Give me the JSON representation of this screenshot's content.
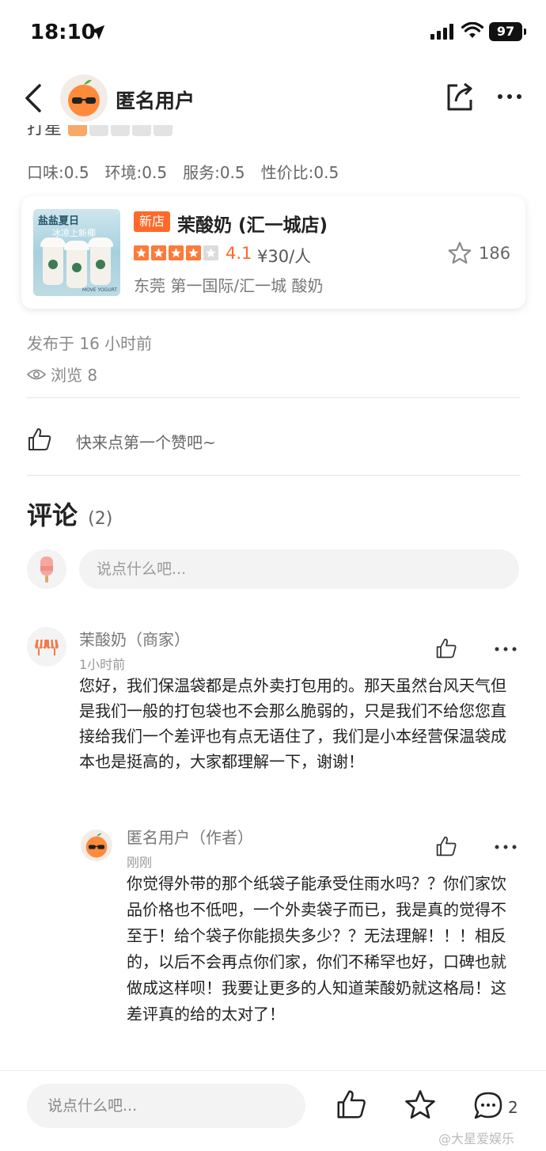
{
  "status_bar": {
    "time": "18:10",
    "battery": "97"
  },
  "nav": {
    "title": "匿名用户"
  },
  "review": {
    "cut_label": "打星",
    "sub_scores": [
      "口味:0.5",
      "环境:0.5",
      "服务:0.5",
      "性价比:0.5"
    ],
    "publish_time": "发布于 16 小时前",
    "views": "浏览 8",
    "like_prompt": "快来点第一个赞吧~"
  },
  "shop": {
    "badge": "新店",
    "name": "茉酸奶 (汇一城店)",
    "stars": 4,
    "rating": "4.1",
    "price": "¥30/人",
    "fav_count": "186",
    "location": "东莞 第一国际/汇一城 酸奶",
    "image_text_1": "盐盐夏日",
    "image_text_2": "冰凉上新椰",
    "image_text_3": "MOVE YOGURT"
  },
  "comments": {
    "title": "评论",
    "count": "(2)",
    "input_placeholder": "说点什么吧...",
    "items": [
      {
        "name": "茉酸奶（商家）",
        "time": "1小时前",
        "text": "您好，我们保温袋都是点外卖打包用的。那天虽然台风天气但是我们一般的打包袋也不会那么脆弱的，只是我们不给您您直接给我们一个差评也有点无语住了，我们是小本经营保温袋成本也是挺高的，大家都理解一下，谢谢！"
      },
      {
        "name": "匿名用户（作者）",
        "time": "刚刚",
        "text": "你觉得外带的那个纸袋子能承受住雨水吗？？你们家饮品价格也不低吧，一个外卖袋子而已，我是真的觉得不至于！给个袋子你能损失多少？？无法理解！！！相反的，以后不会再点你们家，你们不稀罕也好，口碑也就做成这样呗！我要让更多的人知道茉酸奶就这格局！这差评真的给的太对了！"
      }
    ]
  },
  "bottom_bar": {
    "input_placeholder": "说点什么吧...",
    "comment_count": "2",
    "watermark": "@大星爱娱乐"
  },
  "colors": {
    "accent": "#ff6a2a",
    "star_empty": "#dcdcdc",
    "input_bg": "#f3f3f3"
  }
}
